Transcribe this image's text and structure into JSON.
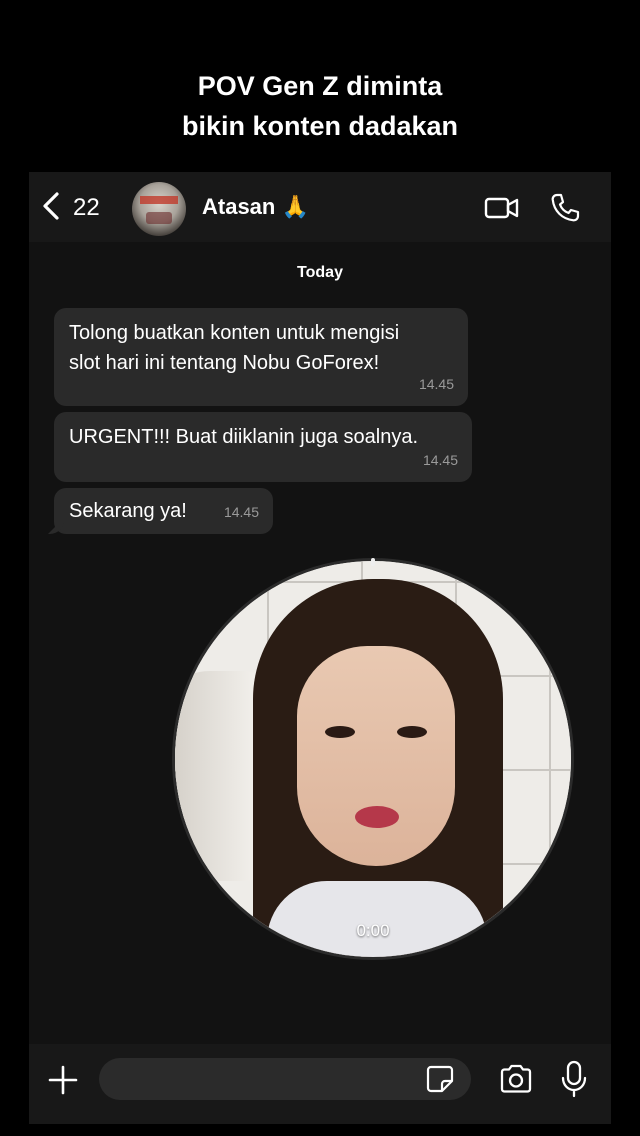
{
  "caption": {
    "line1": "POV Gen Z diminta",
    "line2": "bikin konten dadakan"
  },
  "header": {
    "back_count": "22",
    "contact_name": "Atasan 🙏",
    "icons": {
      "back": "chevron-left-icon",
      "video": "video-camera-icon",
      "call": "phone-icon"
    }
  },
  "chat": {
    "day_divider": "Today",
    "messages": [
      {
        "text_line1": "Tolong buatkan konten untuk mengisi",
        "text_line2": "slot hari ini tentang Nobu GoForex!",
        "time": "14.45"
      },
      {
        "text": "URGENT!!! Buat diiklanin juga soalnya.",
        "time": "14.45"
      },
      {
        "text": "Sekarang ya!",
        "time": "14.45"
      }
    ],
    "video_note": {
      "duration": "0:00"
    }
  },
  "composer": {
    "message_value": "",
    "icons": {
      "attach": "plus-icon",
      "sticker": "sticker-icon",
      "camera": "camera-icon",
      "mic": "microphone-icon"
    }
  },
  "colors": {
    "background": "#000000",
    "chat_background": "#121212",
    "bubble": "#2a2a2a",
    "timestamp": "#9a9a9a"
  }
}
